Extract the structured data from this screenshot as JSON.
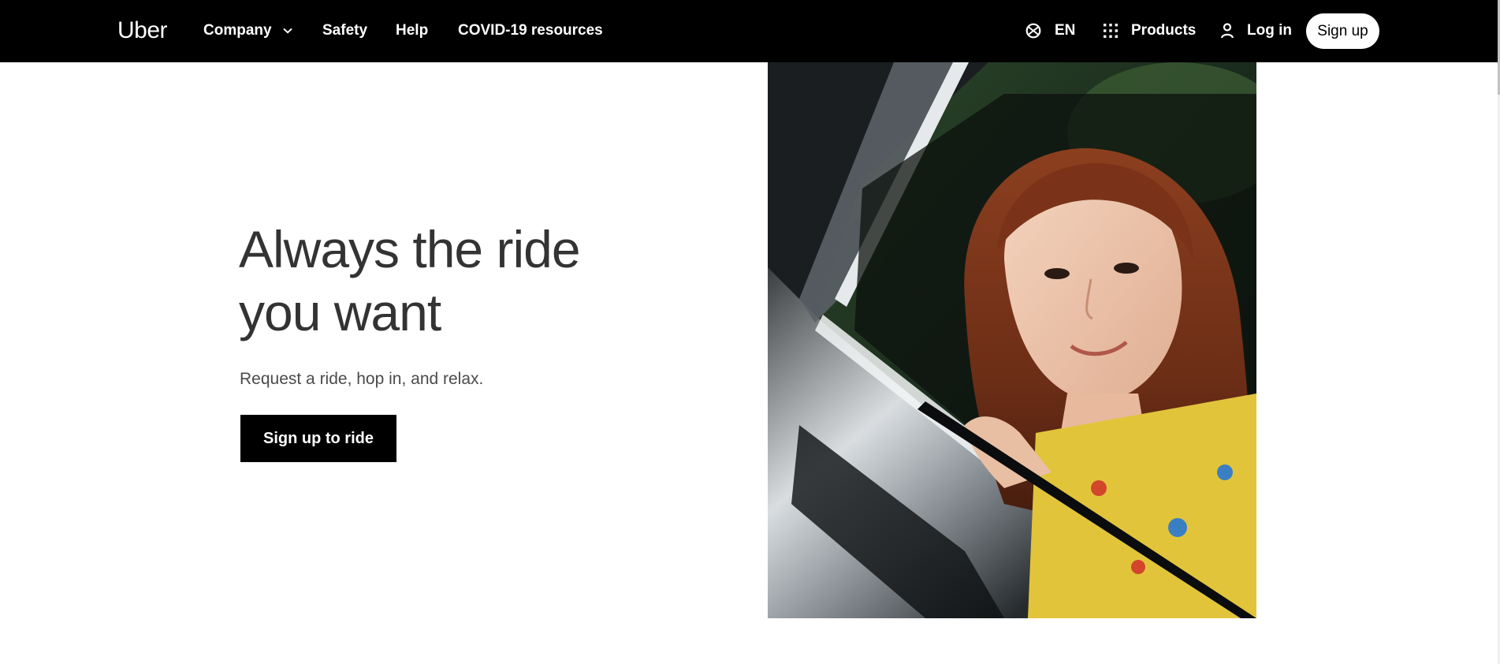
{
  "header": {
    "logo": "Uber",
    "nav": {
      "company": "Company",
      "safety": "Safety",
      "help": "Help",
      "covid": "COVID-19 resources"
    },
    "language": "EN",
    "products": "Products",
    "login": "Log in",
    "signup": "Sign up"
  },
  "hero": {
    "title": "Always the ride you want",
    "subtitle": "Request a ride, hop in, and relax.",
    "cta": "Sign up to ride"
  },
  "icons": {
    "language": "globe-icon",
    "products": "grid-icon",
    "login": "person-icon",
    "company_dropdown": "chevron-down-icon"
  },
  "colors": {
    "header_bg": "#000000",
    "text_primary": "#333333",
    "cta_bg": "#000000",
    "cta_text": "#ffffff"
  }
}
